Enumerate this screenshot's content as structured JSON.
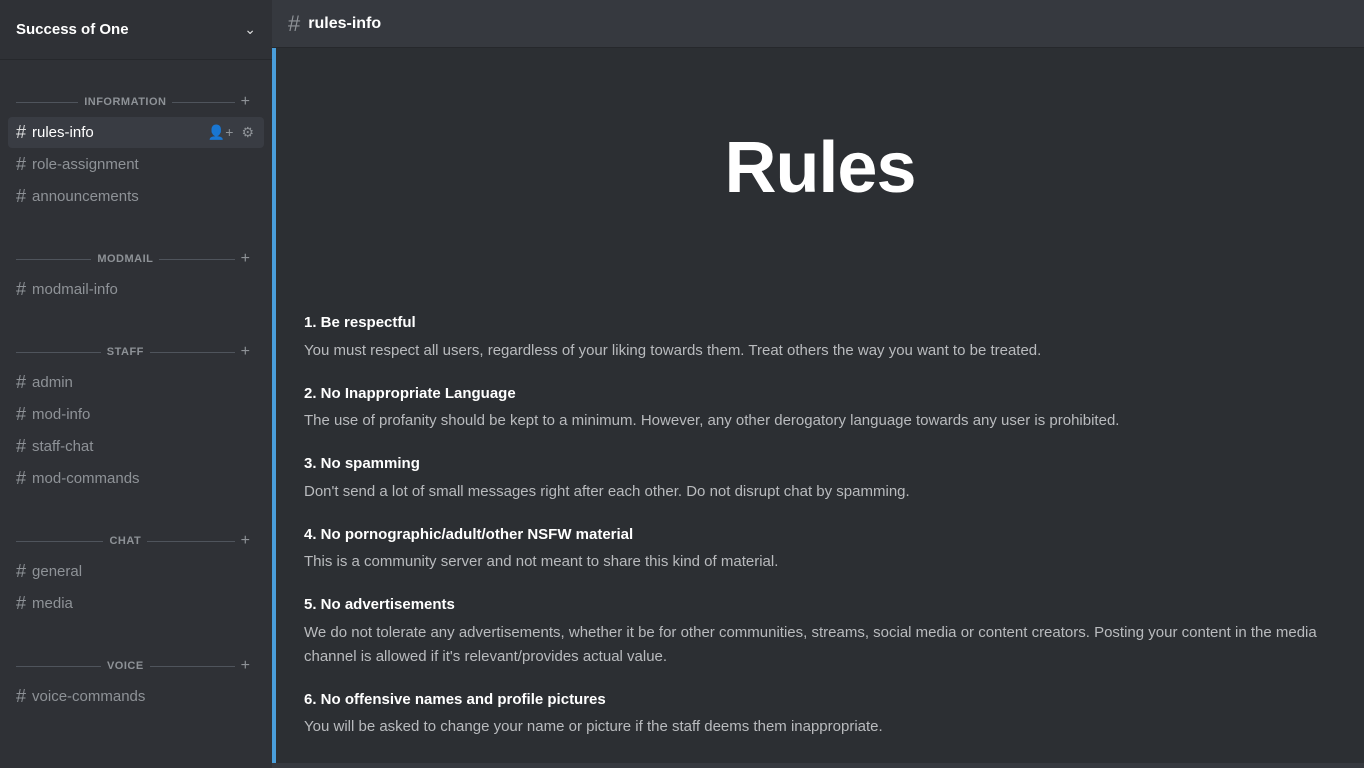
{
  "server": {
    "name": "Success of One",
    "chevron": "∨"
  },
  "header": {
    "channel": "rules-info",
    "hash": "#"
  },
  "sections": [
    {
      "id": "information",
      "label": "INFORMATION",
      "channels": [
        {
          "id": "rules-info",
          "name": "rules-info",
          "active": true
        },
        {
          "id": "role-assignment",
          "name": "role-assignment",
          "active": false
        },
        {
          "id": "announcements",
          "name": "announcements",
          "active": false
        }
      ]
    },
    {
      "id": "modmail",
      "label": "MODMAIL",
      "channels": [
        {
          "id": "modmail-info",
          "name": "modmail-info",
          "active": false
        }
      ]
    },
    {
      "id": "staff",
      "label": "STAFF",
      "channels": [
        {
          "id": "admin",
          "name": "admin",
          "active": false
        },
        {
          "id": "mod-info",
          "name": "mod-info",
          "active": false
        },
        {
          "id": "staff-chat",
          "name": "staff-chat",
          "active": false
        },
        {
          "id": "mod-commands",
          "name": "mod-commands",
          "active": false
        }
      ]
    },
    {
      "id": "chat",
      "label": "CHAT",
      "channels": [
        {
          "id": "general",
          "name": "general",
          "active": false
        },
        {
          "id": "media",
          "name": "media",
          "active": false
        }
      ]
    },
    {
      "id": "voice",
      "label": "VOICE",
      "channels": [
        {
          "id": "voice-commands",
          "name": "voice-commands",
          "active": false
        }
      ]
    }
  ],
  "rules_banner": {
    "title": "Rules"
  },
  "rules": [
    {
      "id": "rule-1",
      "title": "1. Be respectful",
      "body": "You must respect all users, regardless of your liking towards them. Treat others the way you want to be treated."
    },
    {
      "id": "rule-2",
      "title": "2. No Inappropriate Language",
      "body": "The use of profanity should be kept to a minimum. However, any other derogatory language towards any user is prohibited."
    },
    {
      "id": "rule-3",
      "title": "3. No spamming",
      "body": "Don't send a lot of small messages right after each other. Do not disrupt chat by spamming."
    },
    {
      "id": "rule-4",
      "title": "4. No pornographic/adult/other NSFW material",
      "body": "This is a community server and not meant to share this kind of material."
    },
    {
      "id": "rule-5",
      "title": "5. No advertisements",
      "body": "We do not tolerate any advertisements, whether it be for other communities, streams, social media or content creators. Posting your content in the media channel is allowed if it's relevant/provides actual value."
    },
    {
      "id": "rule-6",
      "title": "6. No offensive names and profile pictures",
      "body": "You will be asked to change your name or picture if the staff deems them inappropriate."
    }
  ],
  "icons": {
    "add": "+",
    "hash": "#",
    "add_member": "👤+",
    "settings": "⚙"
  }
}
